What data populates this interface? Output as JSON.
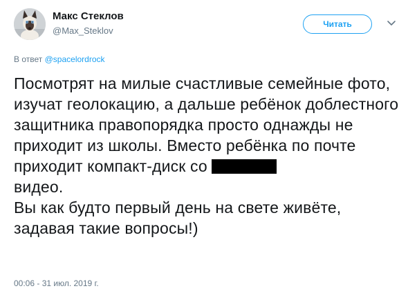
{
  "tweet": {
    "author": {
      "display_name": "Макс Стеклов",
      "handle": "@Max_Steklov"
    },
    "follow_label": "Читать",
    "reply_prefix": "В ответ",
    "reply_to": "@spacelordrock",
    "text_part1": "Посмотрят на милые счастливые семейные фото, изучат геолокацию, а дальше ребёнок доблестного защитника правопорядка просто однажды не приходит из школы. Вместо ребёнка по почте приходит компакт-диск со ",
    "text_part2": "\nвидео.\nВы как будто первый день на свете живёте, задавая такие вопросы!)",
    "timestamp": "00:06 - 31 июл. 2019 г."
  },
  "colors": {
    "accent": "#1da1f2",
    "secondary_text": "#657786",
    "primary_text": "#14171a"
  },
  "icons": {
    "caret": "chevron-down-icon",
    "avatar": "cat-avatar"
  }
}
